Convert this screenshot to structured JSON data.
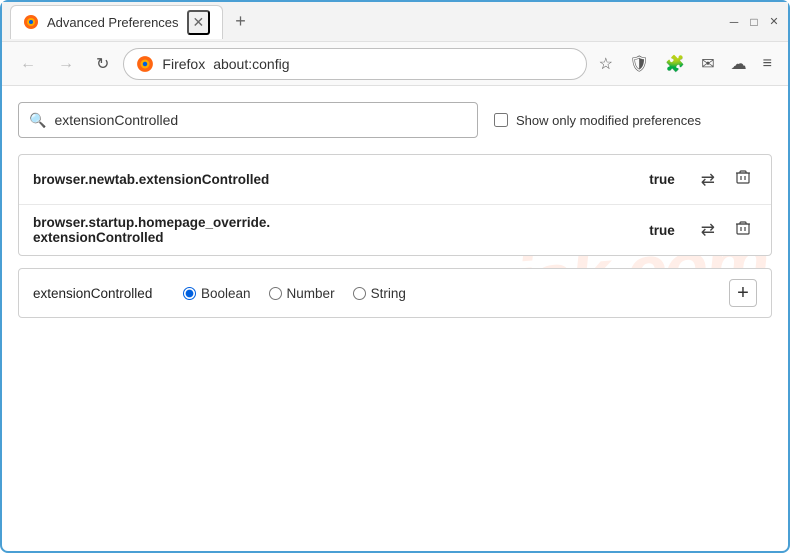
{
  "window": {
    "title": "Advanced Preferences",
    "new_tab_btn": "+",
    "close_label": "✕"
  },
  "titlebar": {
    "tab_title": "Advanced Preferences",
    "tab_close": "✕",
    "new_tab": "+"
  },
  "navbar": {
    "back": "←",
    "forward": "→",
    "reload": "↻",
    "firefox_label": "Firefox",
    "address": "about:config",
    "bookmark_icon": "☆",
    "shield_icon": "🛡",
    "extension_icon": "🧩",
    "mail_icon": "✉",
    "account_icon": "☁",
    "menu_icon": "≡"
  },
  "search": {
    "placeholder": "extensionControlled",
    "show_modified_label": "Show only modified preferences"
  },
  "results": [
    {
      "name": "browser.newtab.extensionControlled",
      "value": "true"
    },
    {
      "name_line1": "browser.startup.homepage_override.",
      "name_line2": "extensionControlled",
      "value": "true"
    }
  ],
  "new_pref": {
    "name": "extensionControlled",
    "types": [
      "Boolean",
      "Number",
      "String"
    ],
    "selected_type": "Boolean",
    "add_btn": "+"
  },
  "icons": {
    "toggle": "⇄",
    "delete": "🗑",
    "search": "🔍"
  },
  "watermark": "risk.com"
}
